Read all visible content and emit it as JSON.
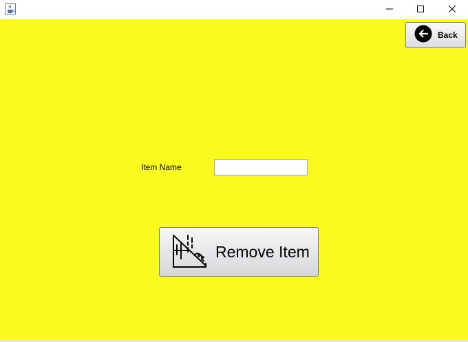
{
  "window": {
    "app_icon": "java-cup-icon",
    "controls": {
      "minimize_icon": "minimize-icon",
      "maximize_icon": "maximize-icon",
      "close_icon": "close-icon"
    }
  },
  "colors": {
    "background": "#fafa1e",
    "button_border": "#7a7a7a"
  },
  "back_button": {
    "label": "Back",
    "icon": "arrow-left-circle-icon"
  },
  "form": {
    "item_name_label": "Item Name",
    "item_name_value": ""
  },
  "remove_button": {
    "label": "Remove Item",
    "icon": "garbage-dump-icon"
  }
}
